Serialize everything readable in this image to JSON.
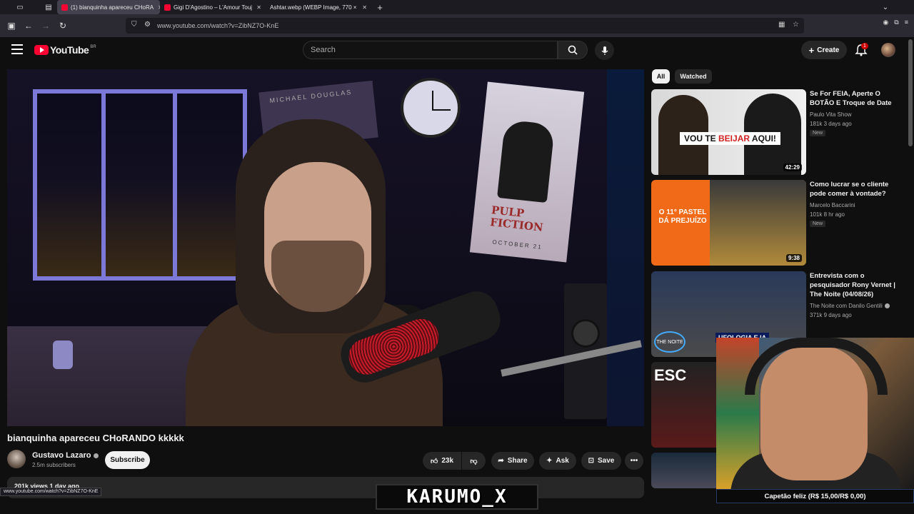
{
  "browser": {
    "tabs": [
      {
        "label": "(1) bianquinha apareceu CHoRA",
        "active": true
      },
      {
        "label": "Gigi D'Agostino – L'Amour Toujo",
        "active": false
      },
      {
        "label": "Ashtar.webp (WEBP Image, 770 × 1",
        "active": false
      }
    ],
    "new_tab": "+",
    "url": "www.youtube.com/watch?v=ZibNZ7O-KnE",
    "status_url": "www.youtube.com/watch?v=ZibNZ7O-KnE"
  },
  "youtube": {
    "logo_text": "YouTube",
    "country_code": "BR",
    "search_placeholder": "Search",
    "create_label": "Create",
    "notification_count": "1"
  },
  "video": {
    "title": "bianquinha apareceu CHoRANDO kkkkk",
    "channel": "Gustavo Lazaro",
    "subscribers": "2.5m subscribers",
    "subscribe_label": "Subscribe",
    "likes": "23k",
    "share_label": "Share",
    "ask_label": "Ask",
    "save_label": "Save",
    "description_peek": "201k views  1 day ago",
    "scene_text": {
      "poster_title": "PULP FICTION",
      "poster_date": "OCTOBER 21",
      "md_poster": "MICHAEL DOUGLAS"
    }
  },
  "sidebar": {
    "chips": [
      "All",
      "Watched"
    ],
    "recommendations": [
      {
        "title": "Se For FEIA, Aperte O BOTÃO E Troque de Date",
        "channel": "Paulo Vita Show",
        "meta": "181k  3 days ago",
        "badge": "New",
        "duration": "42:29",
        "thumb_text_pre": "VOU TE ",
        "thumb_text_em": "BEIJAR",
        "thumb_text_post": " AQUI!"
      },
      {
        "title": "Como lucrar se o cliente pode comer à vontade?",
        "channel": "Marcelo Baccarini",
        "meta": "101k  8 hr ago",
        "badge": "New",
        "duration": "9:38",
        "thumb_text": "O 11° PASTEL DÁ PREJUÍZO"
      },
      {
        "title": "Entrevista com o pesquisador Rony Vernet | The Noite (04/08/26)",
        "channel": "The Noite com Danilo Gentili",
        "meta": "371k  9 days ago",
        "thumb_text": "UFOLOGIA E IA",
        "thumb_logo": "THE NOITE"
      },
      {
        "thumb_text": "ESC"
      }
    ]
  },
  "overlay": {
    "donation_text": "Capetão feliz (R$ 15,00/R$ 0,00)",
    "streamer_tag": "KARUMO_X"
  },
  "colors": {
    "youtube_red": "#ff0033",
    "background": "#0f0f0f",
    "surface": "#272727"
  }
}
